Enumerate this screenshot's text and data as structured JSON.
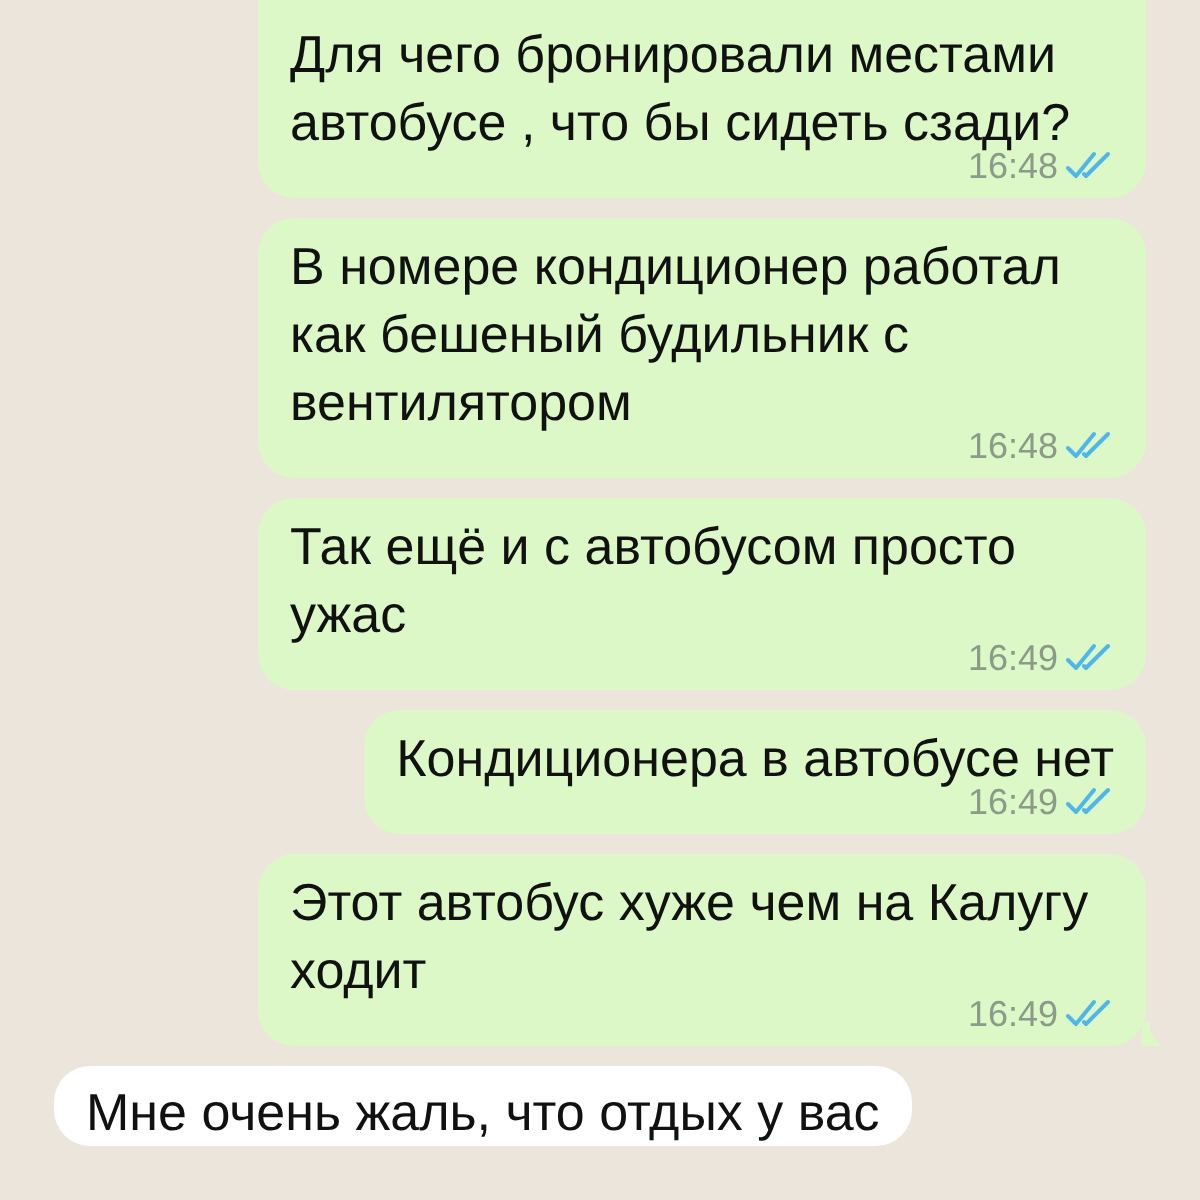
{
  "messages": [
    {
      "kind": "outgoing",
      "text": "Для чего бронировали местами автобусе , что бы сидеть сзади?",
      "time": "16:48",
      "read": true,
      "tail": false
    },
    {
      "kind": "outgoing",
      "text": "В номере кондиционер работал как бешеный будильник с вентилятором",
      "time": "16:48",
      "read": true,
      "tail": false
    },
    {
      "kind": "outgoing",
      "text": "Так ещё и с автобусом просто ужас",
      "time": "16:49",
      "read": true,
      "tail": false
    },
    {
      "kind": "outgoing",
      "text": "Кондиционера в автобусе нет",
      "time": "16:49",
      "read": true,
      "tail": false
    },
    {
      "kind": "outgoing",
      "text": "Этот автобус хуже чем на Калугу ходит",
      "time": "16:49",
      "read": true,
      "tail": true
    },
    {
      "kind": "incoming",
      "text": "Мне очень жаль,  что отдых у вас"
    }
  ]
}
